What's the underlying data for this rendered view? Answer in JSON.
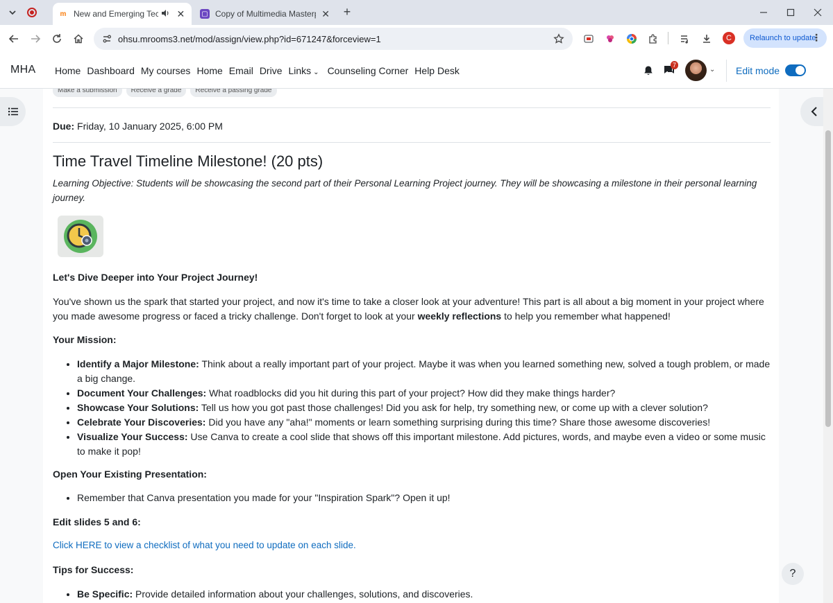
{
  "browser": {
    "tabs": [
      {
        "title": "New and Emerging Technol",
        "active": true,
        "favicon": "moodle-icon",
        "audio": true
      },
      {
        "title": "Copy of Multimedia Masterpiec",
        "active": false,
        "favicon": "canva-icon",
        "audio": false
      }
    ],
    "url": "ohsu.mrooms3.net/mod/assign/view.php?id=671247&forceview=1",
    "profile_initial": "C",
    "relaunch_label": "Relaunch to update"
  },
  "navbar": {
    "brand": "MHA",
    "items": [
      {
        "label": "Home"
      },
      {
        "label": "Dashboard"
      },
      {
        "label": "My courses"
      },
      {
        "label": "Home"
      },
      {
        "label": "Email"
      },
      {
        "label": "Drive"
      },
      {
        "label": "Links",
        "dropdown": true
      },
      {
        "label": "Counseling Corner"
      },
      {
        "label": "Help Desk"
      }
    ],
    "message_count": "7",
    "edit_mode_label": "Edit mode",
    "edit_mode_on": true
  },
  "page": {
    "completion_criteria": [
      "Make a submission",
      "Receive a grade",
      "Receive a passing grade"
    ],
    "due_label": "Due:",
    "due_value": "Friday, 10 January 2025, 6:00 PM",
    "title": "Time Travel Timeline Milestone! (20 pts)",
    "objective": "Learning Objective: Students will be showcasing the second part of their Personal Learning Project journey. They will be showcasing a milestone in their personal learning journey.",
    "dive_heading": "Let's Dive Deeper into Your Project Journey!",
    "intro_before": "You've shown us the spark that started your project, and now it's time to take a closer look at your adventure! This part is all about a big moment in your project where you made awesome progress or faced a tricky challenge.  Don't forget to look at your ",
    "intro_bold": "weekly reflections",
    "intro_after": " to help you remember what happened!",
    "mission_heading": "Your Mission:",
    "mission_items": [
      {
        "bold": "Identify a Major Milestone:",
        "text": " Think about a really important part of your project. Maybe it was when you learned something new, solved a tough problem, or made a big change."
      },
      {
        "bold": "Document Your Challenges:",
        "text": " What roadblocks did you hit during this part of your project? How did they make things harder?"
      },
      {
        "bold": "Showcase Your Solutions:",
        "text": " Tell us how you got past those challenges! Did you ask for help, try something new, or come up with a clever solution?"
      },
      {
        "bold": "Celebrate Your Discoveries:",
        "text": " Did you have any \"aha!\" moments or learn something surprising during this time? Share those awesome discoveries!"
      },
      {
        "bold": "Visualize Your Success:",
        "text": " Use Canva to create a cool slide that shows off this important milestone. Add pictures, words, and maybe even a video or some music to make it pop!"
      }
    ],
    "open_heading": "Open Your Existing Presentation:",
    "open_item": "Remember that Canva presentation you made for your \"Inspiration Spark\"? Open it up!",
    "edit_heading": "Edit slides 5 and 6:",
    "checklist_link": "Click HERE to view a checklist of what you need to update on each slide.",
    "tips_heading": "Tips for Success:",
    "tips_items": [
      {
        "bold": "Be Specific:",
        "text": " Provide detailed information about your challenges, solutions, and discoveries."
      }
    ],
    "help_label": "?"
  },
  "colors": {
    "link": "#0f6cbf",
    "badge": "#ca3120",
    "tabbar": "#dfe3eb"
  }
}
